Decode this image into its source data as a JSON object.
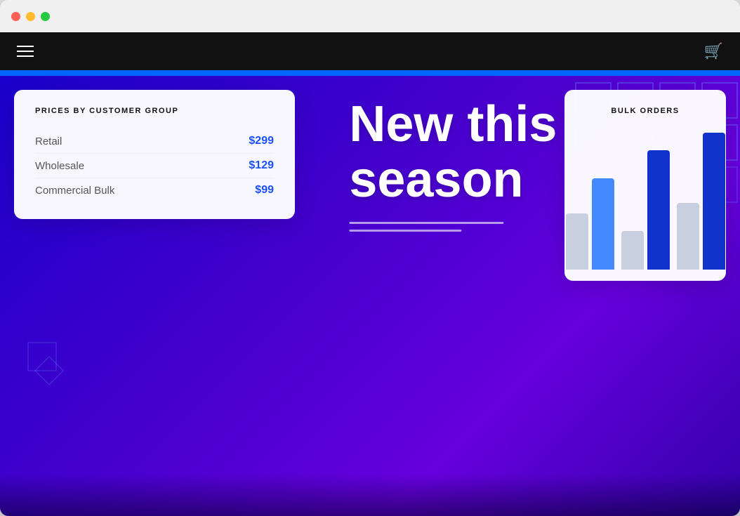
{
  "browser": {
    "dots": [
      "red",
      "yellow",
      "green"
    ]
  },
  "nav": {
    "hamburger_label": "Menu",
    "cart_label": "Cart"
  },
  "hero": {
    "headline_line1": "New this",
    "headline_line2": "season"
  },
  "prices_card": {
    "title": "PRICES BY CUSTOMER GROUP",
    "rows": [
      {
        "label": "Retail",
        "price": "$299"
      },
      {
        "label": "Wholesale",
        "price": "$129"
      },
      {
        "label": "Commercial Bulk",
        "price": "$99"
      }
    ]
  },
  "bulk_card": {
    "title": "BULK ORDERS",
    "bars": [
      {
        "label": "bar1",
        "gray_height": 80,
        "blue_height": 140
      },
      {
        "label": "bar2",
        "gray_height": 60,
        "blue_height": 180
      },
      {
        "label": "bar3",
        "gray_height": 100,
        "blue_height": 200
      }
    ]
  },
  "colors": {
    "accent_blue": "#1a4fff",
    "background_gradient_start": "#1a00cc",
    "background_gradient_end": "#6600dd",
    "nav_bg": "#111111",
    "stripe_blue": "#0066ff"
  }
}
